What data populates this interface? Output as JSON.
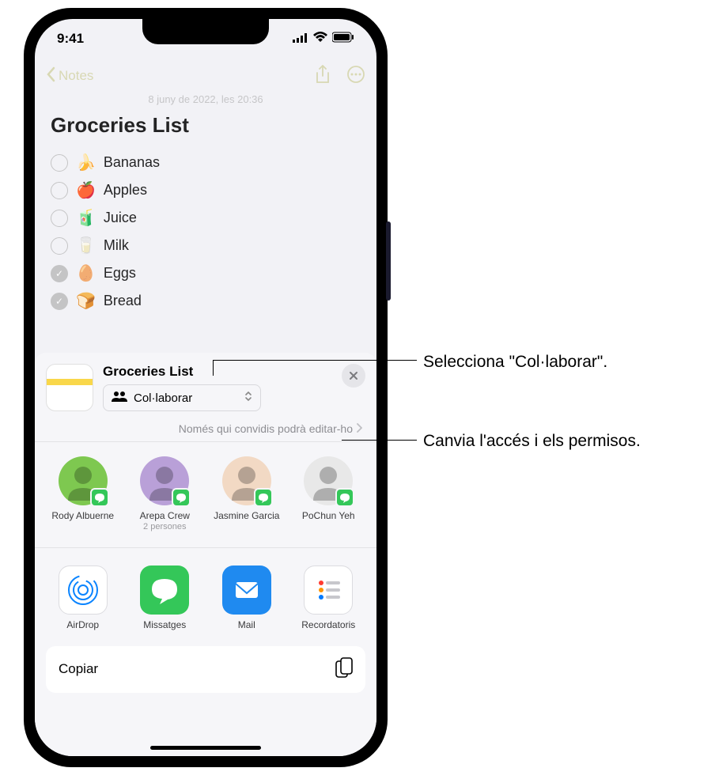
{
  "status": {
    "time": "9:41"
  },
  "nav": {
    "back": "Notes",
    "date": "8 juny de 2022, les 20:36"
  },
  "note": {
    "title": "Groceries List",
    "items": [
      {
        "emoji": "🍌",
        "text": "Bananas",
        "checked": false
      },
      {
        "emoji": "🍎",
        "text": "Apples",
        "checked": false
      },
      {
        "emoji": "🧃",
        "text": "Juice",
        "checked": false
      },
      {
        "emoji": "🥛",
        "text": "Milk",
        "checked": false
      },
      {
        "emoji": "🥚",
        "text": "Eggs",
        "checked": true
      },
      {
        "emoji": "🍞",
        "text": "Bread",
        "checked": true
      }
    ]
  },
  "sheet": {
    "title": "Groceries List",
    "collab_label": "Col·laborar",
    "permissions": "Només qui convidis podrà editar-ho",
    "contacts": [
      {
        "name": "Rody Albuerne",
        "sub": "",
        "bg": "#7ec850"
      },
      {
        "name": "Arepa Crew",
        "sub": "2 persones",
        "bg": "#b9a0d8"
      },
      {
        "name": "Jasmine Garcia",
        "sub": "",
        "bg": "#f2d9c4"
      },
      {
        "name": "PoChun Yeh",
        "sub": "",
        "bg": "#e8e8e8"
      }
    ],
    "apps": [
      {
        "label": "AirDrop",
        "bg": "#fff",
        "border": "#dcdce0"
      },
      {
        "label": "Missatges",
        "bg": "#34c759"
      },
      {
        "label": "Mail",
        "bg": "#1f8af0"
      },
      {
        "label": "Recordatoris",
        "bg": "#fff",
        "border": "#dcdce0"
      }
    ],
    "copy": "Copiar"
  },
  "callouts": {
    "c1": "Selecciona \"Col·laborar\".",
    "c2": "Canvia l'accés i els permisos."
  }
}
